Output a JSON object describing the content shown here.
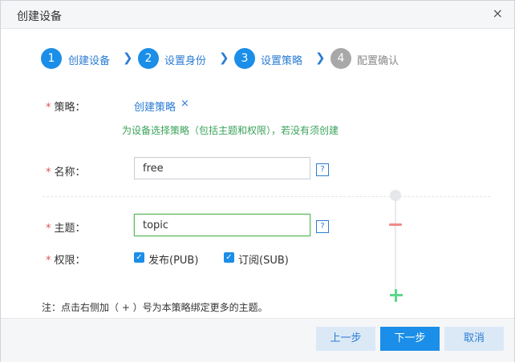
{
  "dialog": {
    "title": "创建设备",
    "close_glyph": "×"
  },
  "steps": [
    {
      "num": "1",
      "label": "创建设备"
    },
    {
      "num": "2",
      "label": "设置身份"
    },
    {
      "num": "3",
      "label": "设置策略"
    },
    {
      "num": "4",
      "label": "配置确认"
    }
  ],
  "steps_state": {
    "active_count": 3,
    "current": 3
  },
  "form": {
    "required_mark": "*",
    "policy": {
      "label": "策略：",
      "link": "创建策略",
      "remove_glyph": "×",
      "hint": "为设备选择策略（包括主题和权限），若没有须创建"
    },
    "name": {
      "label": "名称：",
      "value": "free",
      "help": "?"
    },
    "topic": {
      "label": "主题：",
      "value": "topic",
      "help": "?"
    },
    "permission": {
      "label": "权限：",
      "options": [
        {
          "label": "发布(PUB)",
          "checked": true
        },
        {
          "label": "订阅(SUB)",
          "checked": true
        }
      ]
    },
    "check_glyph": "✓"
  },
  "note": "注：点击右侧加（ + ）号为本策略绑定更多的主题。",
  "footer": {
    "prev": "上一步",
    "next": "下一步",
    "cancel": "取消"
  },
  "colors": {
    "accent": "#1a8ee8",
    "link": "#2b7cd3",
    "hint": "#3aa35a",
    "required": "#e05050",
    "remove": "#f08a8a",
    "add": "#5fd68c"
  }
}
